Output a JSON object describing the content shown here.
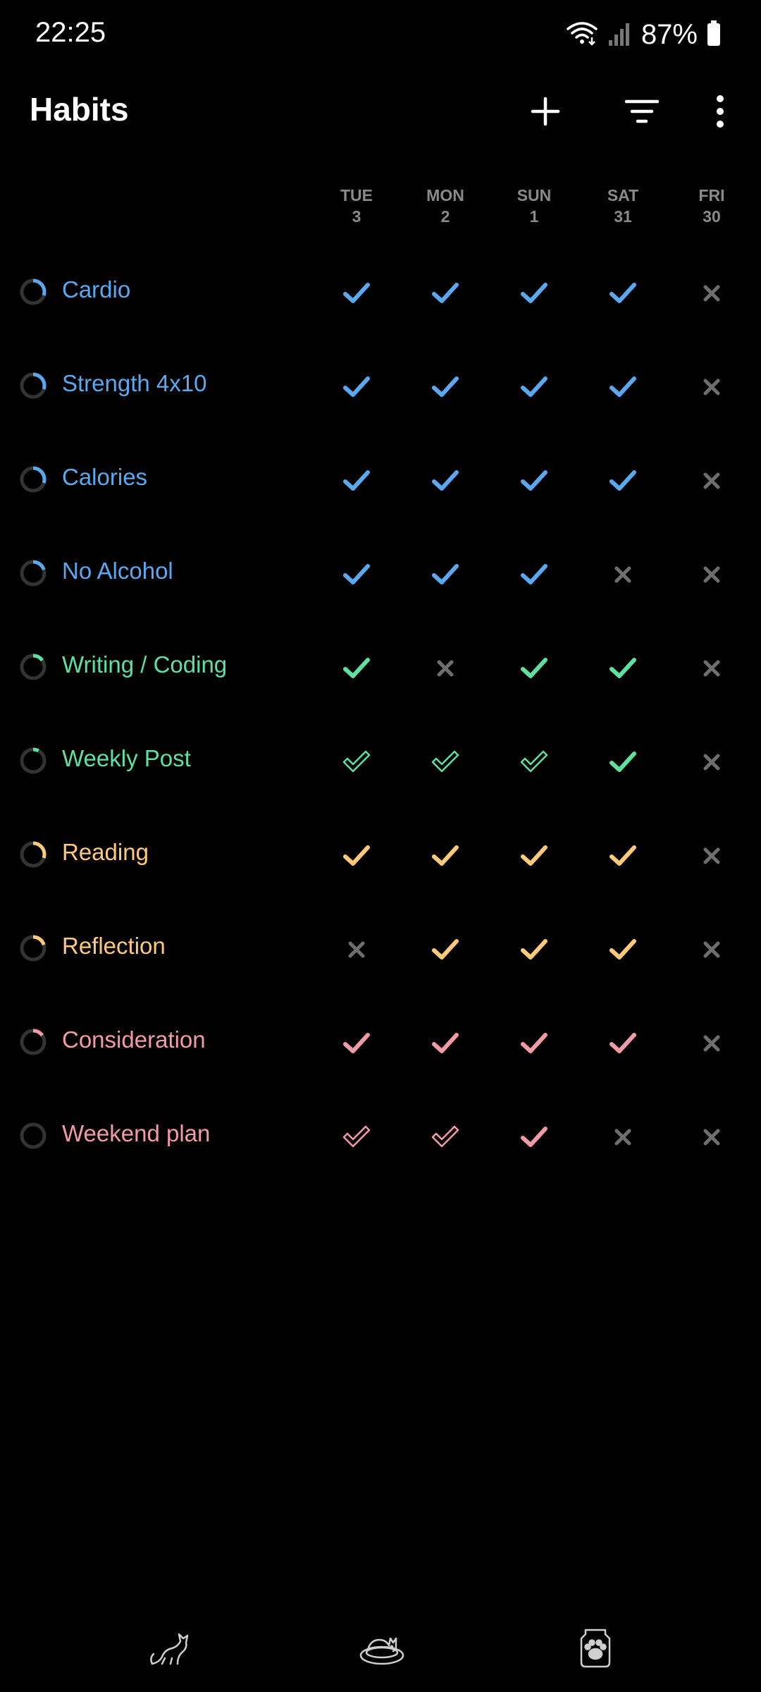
{
  "status_bar": {
    "time": "22:25",
    "battery": "87%",
    "icons": [
      "wifi-calling-icon",
      "signal-icon",
      "battery-icon"
    ]
  },
  "app_bar": {
    "title": "Habits",
    "actions": [
      "add-icon",
      "filter-icon",
      "more-vert-icon"
    ]
  },
  "days": [
    {
      "name": "TUE",
      "num": "3"
    },
    {
      "name": "MON",
      "num": "2"
    },
    {
      "name": "SUN",
      "num": "1"
    },
    {
      "name": "SAT",
      "num": "31"
    },
    {
      "name": "FRI",
      "num": "30"
    }
  ],
  "colors": {
    "blue": "#5aa9f0",
    "green": "#5de0a0",
    "yellow": "#ffc97a",
    "pink": "#f29aa6",
    "gray": "#6e6e6e"
  },
  "habits": [
    {
      "name": "Cardio",
      "color": "blue",
      "progress": 0.3,
      "marks": [
        "check",
        "check",
        "check",
        "check",
        "x"
      ]
    },
    {
      "name": "Strength 4x10",
      "color": "blue",
      "progress": 0.3,
      "marks": [
        "check",
        "check",
        "check",
        "check",
        "x"
      ]
    },
    {
      "name": "Calories",
      "color": "blue",
      "progress": 0.3,
      "marks": [
        "check",
        "check",
        "check",
        "check",
        "x"
      ]
    },
    {
      "name": "No Alcohol",
      "color": "blue",
      "progress": 0.2,
      "marks": [
        "check",
        "check",
        "check",
        "x",
        "x"
      ]
    },
    {
      "name": "Writing / Coding",
      "color": "green",
      "progress": 0.15,
      "marks": [
        "check",
        "x",
        "check",
        "check",
        "x"
      ]
    },
    {
      "name": "Weekly Post",
      "color": "green",
      "progress": 0.08,
      "marks": [
        "check-outline",
        "check-outline",
        "check-outline",
        "check",
        "x"
      ]
    },
    {
      "name": "Reading",
      "color": "yellow",
      "progress": 0.3,
      "marks": [
        "check",
        "check",
        "check",
        "check",
        "x"
      ]
    },
    {
      "name": "Reflection",
      "color": "yellow",
      "progress": 0.2,
      "marks": [
        "x",
        "check",
        "check",
        "check",
        "x"
      ]
    },
    {
      "name": "Consideration",
      "color": "pink",
      "progress": 0.15,
      "marks": [
        "check",
        "check",
        "check",
        "check",
        "x"
      ]
    },
    {
      "name": "Weekend plan",
      "color": "pink",
      "progress": 0.0,
      "marks": [
        "check-outline",
        "check-outline",
        "check",
        "x",
        "x"
      ]
    }
  ],
  "bottom_nav": [
    "cat-stretching-icon",
    "cat-sleeping-bed-icon",
    "paw-badge-icon"
  ]
}
